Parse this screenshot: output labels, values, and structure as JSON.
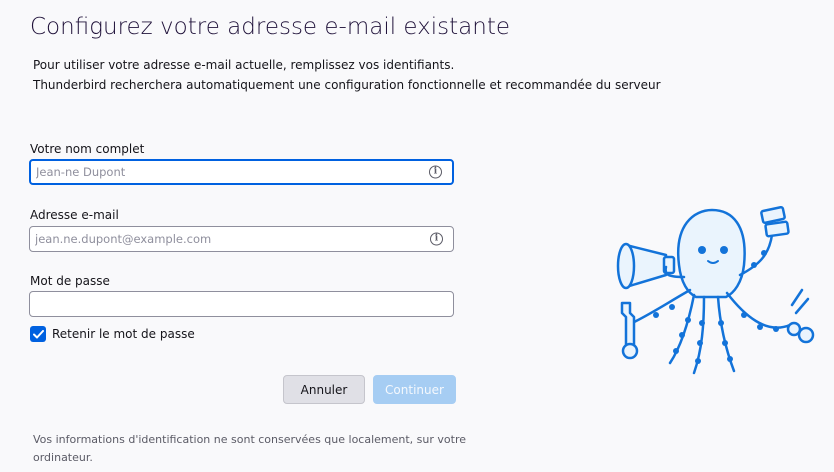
{
  "header": {
    "title": "Configurez votre adresse e-mail existante",
    "description_line1": "Pour utiliser votre adresse e-mail actuelle, remplissez vos identifiants.",
    "description_line2": "Thunderbird recherchera automatiquement une configuration fonctionnelle et recommandée du serveur"
  },
  "form": {
    "name": {
      "label": "Votre nom complet",
      "placeholder": "Jean-ne Dupont",
      "value": ""
    },
    "email": {
      "label": "Adresse e-mail",
      "placeholder": "jean.ne.dupont@example.com",
      "value": ""
    },
    "password": {
      "label": "Mot de passe",
      "value": ""
    },
    "remember": {
      "label": "Retenir le mot de passe",
      "checked": true
    }
  },
  "buttons": {
    "cancel": "Annuler",
    "continue": "Continuer"
  },
  "info_icon_glyph": "i",
  "footnote": "Vos informations d'identification ne sont conservées que localement, sur votre ordinateur.",
  "colors": {
    "accent": "#0061e0",
    "button_disabled": "#a6cdf3",
    "mascot_outline": "#1373d9",
    "mascot_fill": "#eaf4fd"
  }
}
